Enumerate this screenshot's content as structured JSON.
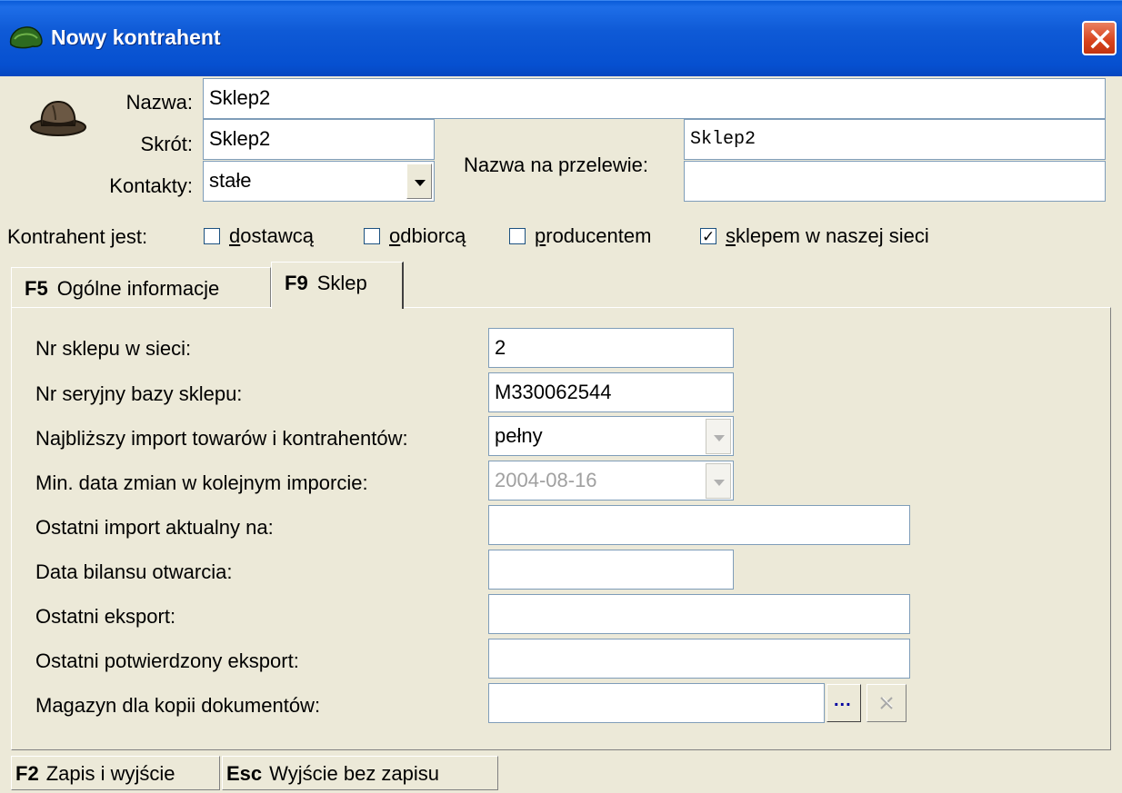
{
  "window": {
    "title": "Nowy kontrahent"
  },
  "header": {
    "name_label": "Nazwa:",
    "name_value": "Sklep2",
    "short_label": "Skrót:",
    "short_value": "Sklep2",
    "contacts_label": "Kontakty:",
    "contacts_value": "stałe",
    "transfer_label": "Nazwa na przelewie:",
    "transfer_line1": "Sklep2",
    "transfer_line2": "",
    "role_label": "Kontrahent jest:",
    "roles": [
      {
        "label": "dostawcą",
        "checked": false
      },
      {
        "label": "odbiorcą",
        "checked": false
      },
      {
        "label": "producentem",
        "checked": false
      },
      {
        "label": "sklepem w naszej sieci",
        "checked": true
      }
    ]
  },
  "tabs": [
    {
      "key": "F5",
      "label": "Ogólne informacje"
    },
    {
      "key": "F9",
      "label": "Sklep"
    }
  ],
  "shop": {
    "nr_label": "Nr sklepu w sieci:",
    "nr_value": "2",
    "serial_label": "Nr seryjny bazy sklepu:",
    "serial_value": "M330062544",
    "import_label": "Najbliższy import towarów i kontrahentów:",
    "import_value": "pełny",
    "mindate_label": "Min. data zmian w kolejnym imporcie:",
    "mindate_value": "2004-08-16",
    "lastimport_label": "Ostatni import aktualny na:",
    "lastimport_value": "",
    "balance_label": "Data bilansu otwarcia:",
    "balance_value": "",
    "lastexport_label": "Ostatni eksport:",
    "lastexport_value": "",
    "confexport_label": "Ostatni potwierdzony eksport:",
    "confexport_value": "",
    "warehouse_label": "Magazyn dla kopii dokumentów:",
    "warehouse_value": "",
    "browse_label": "..."
  },
  "footer": [
    {
      "key": "F2",
      "label": "Zapis i wyjście"
    },
    {
      "key": "Esc",
      "label": "Wyjście bez zapisu"
    }
  ],
  "icons": {
    "app": "green-turtle-icon",
    "header": "fedora-hat-icon",
    "close": "close-icon",
    "clear": "clear-icon"
  }
}
